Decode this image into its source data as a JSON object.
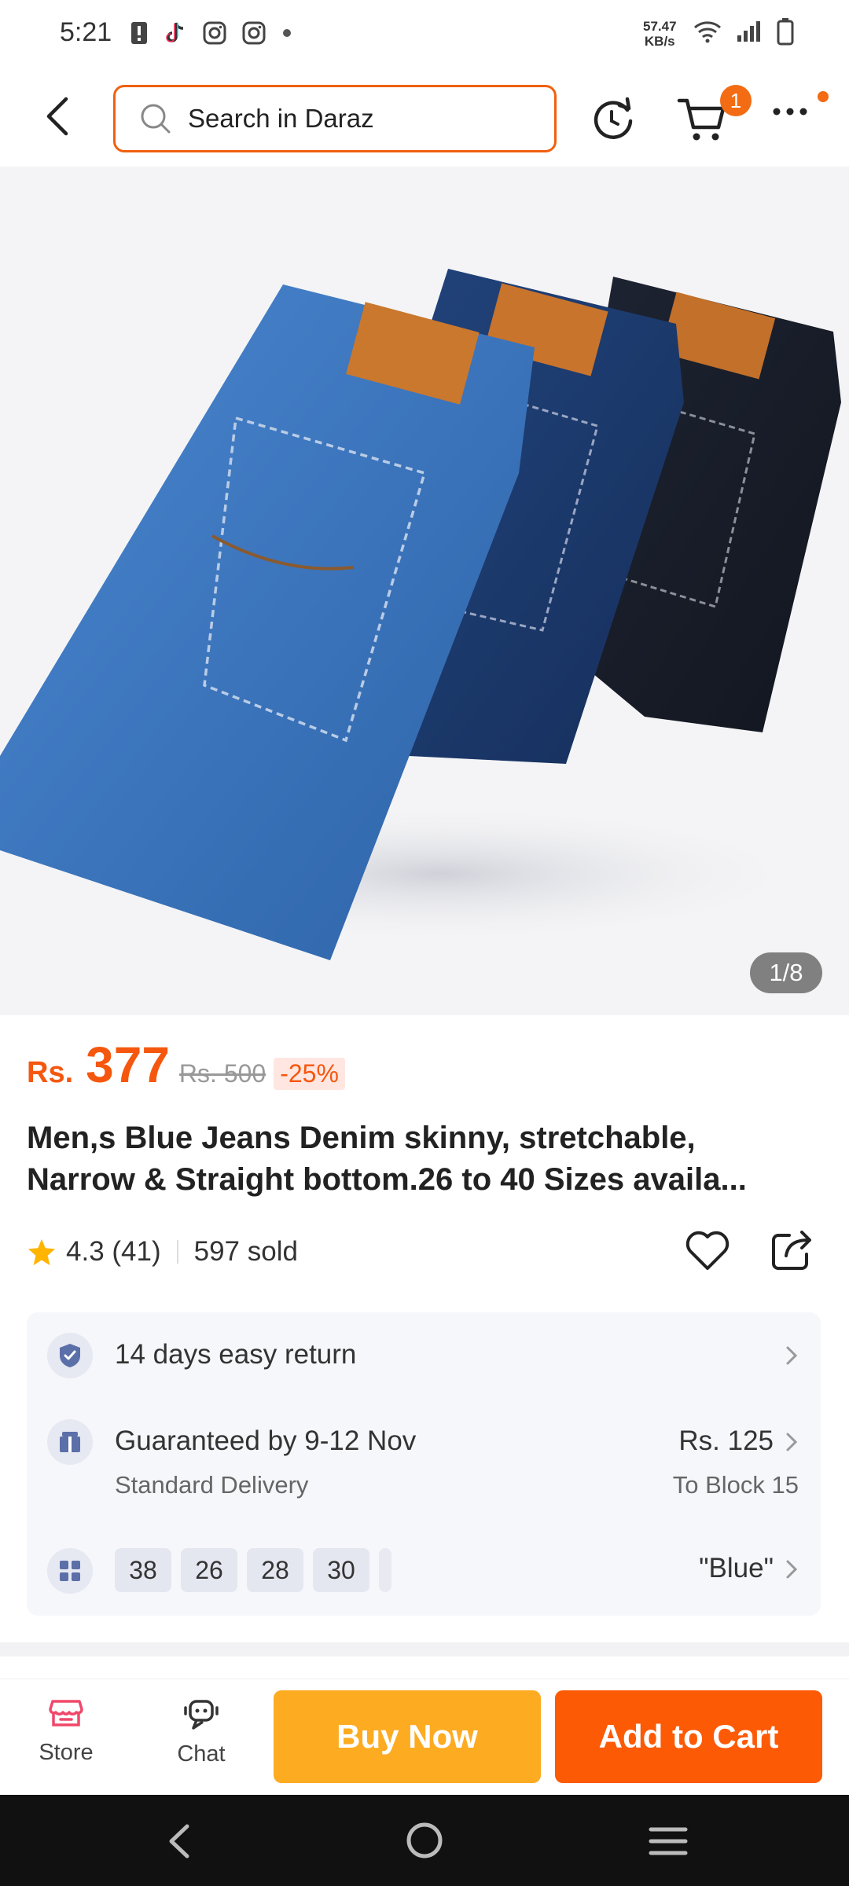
{
  "status": {
    "time": "5:21",
    "speed_value": "57.47",
    "speed_unit": "KB/s"
  },
  "header": {
    "search_placeholder": "Search in Daraz",
    "cart_count": "1"
  },
  "gallery": {
    "counter": "1/8",
    "image_subject": "three folded pairs of jeans (light blue, dark blue, black)"
  },
  "price": {
    "currency": "Rs.",
    "amount": "377",
    "original": "Rs. 500",
    "discount": "-25%"
  },
  "product": {
    "title_line1": "Men,s Blue Jeans Denim skinny, stretchable,",
    "title_line2": "Narrow & Straight bottom.26 to 40 Sizes availa..."
  },
  "rating": {
    "score": "4.3 (41)",
    "sold": "597 sold"
  },
  "card": {
    "return_text": "14 days easy return",
    "delivery_text": "Guaranteed by 9-12 Nov",
    "delivery_sub": "Standard Delivery",
    "delivery_price": "Rs. 125",
    "delivery_location": "To Block 15",
    "sizes": [
      "38",
      "26",
      "28",
      "30"
    ],
    "variant": "\"Blue\""
  },
  "bottombar": {
    "store_label": "Store",
    "chat_label": "Chat",
    "buy_label": "Buy Now",
    "cart_label": "Add to Cart"
  },
  "colors": {
    "accent": "#f5570e",
    "buy_now": "#fdab21",
    "add_to_cart": "#fd5a06"
  }
}
